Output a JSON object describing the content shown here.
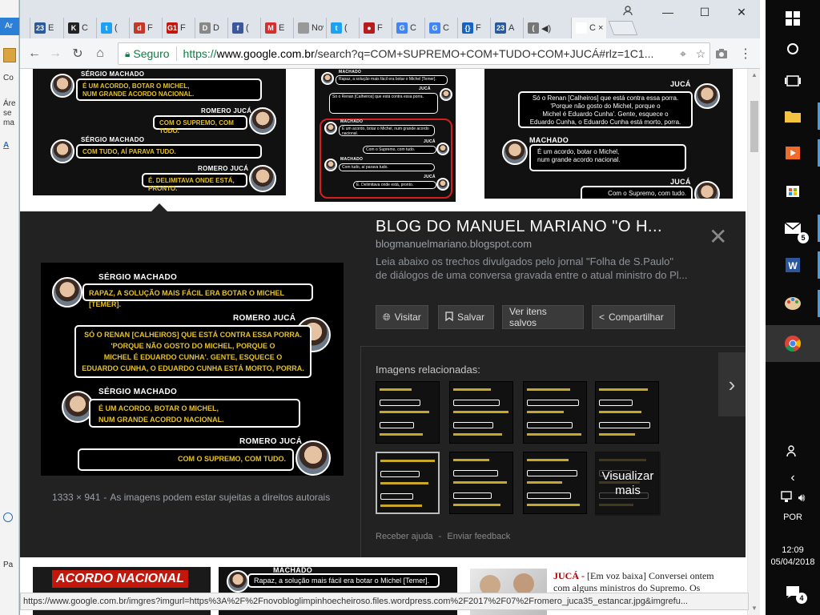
{
  "background_app": {
    "fragments": [
      "Ar",
      "Co",
      "Áre",
      "se",
      "ma",
      "A",
      "Pa"
    ]
  },
  "window": {
    "tabs": [
      {
        "fav": "23",
        "label": "E",
        "color": "#2a5a9a"
      },
      {
        "fav": "K",
        "label": "C",
        "color": "#222"
      },
      {
        "fav": "t",
        "label": "(",
        "color": "#1da1f2"
      },
      {
        "fav": "d",
        "label": "F",
        "color": "#c0392b"
      },
      {
        "fav": "G1",
        "label": "F",
        "color": "#c4170c"
      },
      {
        "fav": "D",
        "label": "D",
        "color": "#888"
      },
      {
        "fav": "f",
        "label": "(",
        "color": "#3b5998"
      },
      {
        "fav": "M",
        "label": "E",
        "color": "#d32f2f"
      },
      {
        "fav": "",
        "label": "Nov",
        "color": "#999"
      },
      {
        "fav": "t",
        "label": "(",
        "color": "#1da1f2"
      },
      {
        "fav": "●",
        "label": "F",
        "color": "#b71c1c"
      },
      {
        "fav": "G",
        "label": "C",
        "color": "#4285f4"
      },
      {
        "fav": "G",
        "label": "C",
        "color": "#4285f4"
      },
      {
        "fav": "{}",
        "label": "F",
        "color": "#1565c0"
      },
      {
        "fav": "23",
        "label": "A",
        "color": "#2a5a9a"
      },
      {
        "fav": "(",
        "label": "◀)",
        "color": "#777"
      },
      {
        "fav": "",
        "label": "C ×",
        "color": "#fff"
      }
    ],
    "controls": {
      "minimize": "—",
      "maximize": "☐",
      "close": "✕"
    }
  },
  "toolbar": {
    "secure_label": "Seguro",
    "url_prefix": "https://",
    "url_host": "www.google.com.br",
    "url_rest": "/search?q=COM+SUPREMO+COM+TUDO+COM+JUCÁ#rlz=1C1..."
  },
  "results_top": {
    "img1": {
      "names": [
        "SÉRGIO MACHADO",
        "ROMERO JUCÁ",
        "SÉRGIO MACHADO",
        "ROMERO JUCÁ"
      ],
      "lines": [
        "É UM ACORDO, BOTAR O MICHEL,",
        "NUM GRANDE ACORDO NACIONAL.",
        "COM O SUPREMO, COM TUDO.",
        "COM TUDO, AÍ PARAVA TUDO.",
        "É. DELIMITAVA ONDE ESTÁ, PRONTO."
      ]
    },
    "img2": {
      "names": [
        "MACHADO",
        "JUCÁ",
        "MACHADO",
        "JUCÁ",
        "MACHADO",
        "JUCÁ"
      ],
      "lines": [
        "Rapaz, a solução mais fácil era botar o Michel [Temer].",
        "Só o Renan [Calheiros] que está contra essa porra.",
        "É um acordo, botar o Michel, num grande acordo nacional.",
        "Com o Supremo, com tudo.",
        "Com tudo, aí parava tudo.",
        "É. Delimitava onde está, pronto."
      ]
    },
    "img3": {
      "names": [
        "JUCÁ",
        "MACHADO",
        "JUCÁ"
      ],
      "lines": [
        "Só o Renan [Calheiros] que está contra essa porra.",
        "'Porque não gosto do Michel, porque o",
        "Michel é Eduardo Cunha'. Gente, esquece o",
        "Eduardo Cunha, o Eduardo Cunha está morto, porra.",
        "É um acordo, botar o Michel,",
        "num grande acordo nacional.",
        "Com o Supremo, com tudo."
      ]
    }
  },
  "preview": {
    "title": "BLOG DO MANUEL MARIANO \"O H...",
    "domain": "blogmanuelmariano.blogspot.com",
    "description": "Leia abaixo os trechos divulgados pelo jornal \"Folha de S.Paulo\" de diálogos de uma conversa gravada entre o atual ministro do Pl...",
    "buttons": {
      "visit": "Visitar",
      "save": "Salvar",
      "saved": "Ver itens salvos",
      "share": "Compartilhar"
    },
    "dimensions": "1333 × 941",
    "dims_sep": "-",
    "copyright": "As imagens podem estar sujeitas a direitos autorais",
    "related_heading": "Imagens relacionadas:",
    "more_label": "Visualizar mais",
    "help": "Receber ajuda",
    "footer_sep": "-",
    "feedback": "Enviar feedback",
    "big_image": {
      "names": [
        "SÉRGIO MACHADO",
        "ROMERO JUCÁ",
        "SÉRGIO MACHADO",
        "ROMERO JUCÁ"
      ],
      "line1": "RAPAZ, A SOLUÇÃO MAIS FÁCIL ERA BOTAR O MICHEL [TEMER].",
      "line2a": "SÓ O RENAN [CALHEIROS] QUE ESTÁ CONTRA ESSA PORRA.",
      "line2b": "'PORQUE NÃO GOSTO DO MICHEL, PORQUE O",
      "line2c": "MICHEL É EDUARDO CUNHA'. GENTE, ESQUECE O",
      "line2d": "EDUARDO CUNHA, O EDUARDO CUNHA ESTÁ MORTO, PORRA.",
      "line3a": "É UM ACORDO, BOTAR O MICHEL,",
      "line3b": "NUM GRANDE ACORDO NACIONAL.",
      "line4": "COM O SUPREMO, COM TUDO."
    }
  },
  "results_bottom": {
    "img1_label": "ACORDO NACIONAL",
    "img2_name": "MACHADO",
    "img2_text": "Rapaz, a solução mais fácil era botar o Michel [Temer].",
    "img3_name": "JUCÁ -",
    "img3_text": "[Em voz baixa] Conversei ontem com alguns ministros do Supremo. Os"
  },
  "status_url": "https://www.google.com.br/imgres?imgurl=https%3A%2F%2Fnovobloglimpinhoecheiroso.files.wordpress.com%2F2017%2F07%2Fromero_juca35_estancar.jpg&imgrefu...",
  "taskbar": {
    "mail_badge": "5",
    "lang": "POR",
    "time": "12:09",
    "date": "05/04/2018",
    "notif_badge": "4"
  }
}
